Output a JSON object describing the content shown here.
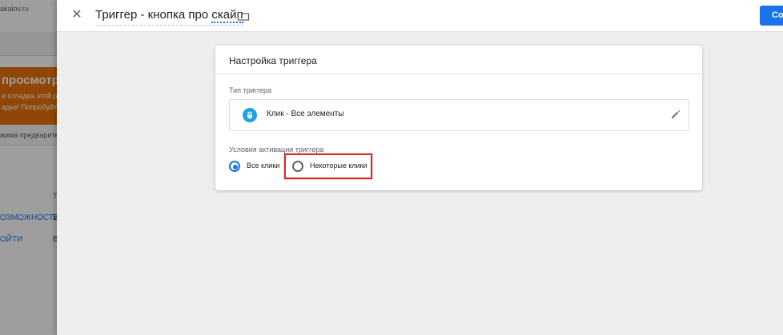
{
  "background_page": {
    "url_fragment": "akalov.ru",
    "banner_title": "просмотр р",
    "banner_line1": "и отладка этой р",
    "banner_line2": "адке! Попробуйт",
    "subheader": "жима предварител",
    "column_letter": "Т",
    "link1": "ОЗМОЖНОСТИ",
    "link2": "ОЙТИ",
    "cell1": "В",
    "cell2": "В"
  },
  "header": {
    "title_prefix": "Триггер - кнопка про ",
    "title_marked": "скайп",
    "save_label": "Со"
  },
  "card": {
    "title": "Настройка триггера",
    "type_section_label": "Тип триггера",
    "trigger_type": "Клик - Все элементы",
    "conditions_label": "Условия активации триггера",
    "options": [
      {
        "label": "Все клики",
        "selected": true
      },
      {
        "label": "Некоторые клики",
        "selected": false
      }
    ]
  },
  "colors": {
    "accent": "#1a73e8",
    "banner": "#e8710a",
    "highlight": "#d32f2f",
    "trigger_icon": "#1fa3e0"
  },
  "icons": [
    "close-icon",
    "folder-icon",
    "click-trigger-icon",
    "pencil-icon"
  ]
}
